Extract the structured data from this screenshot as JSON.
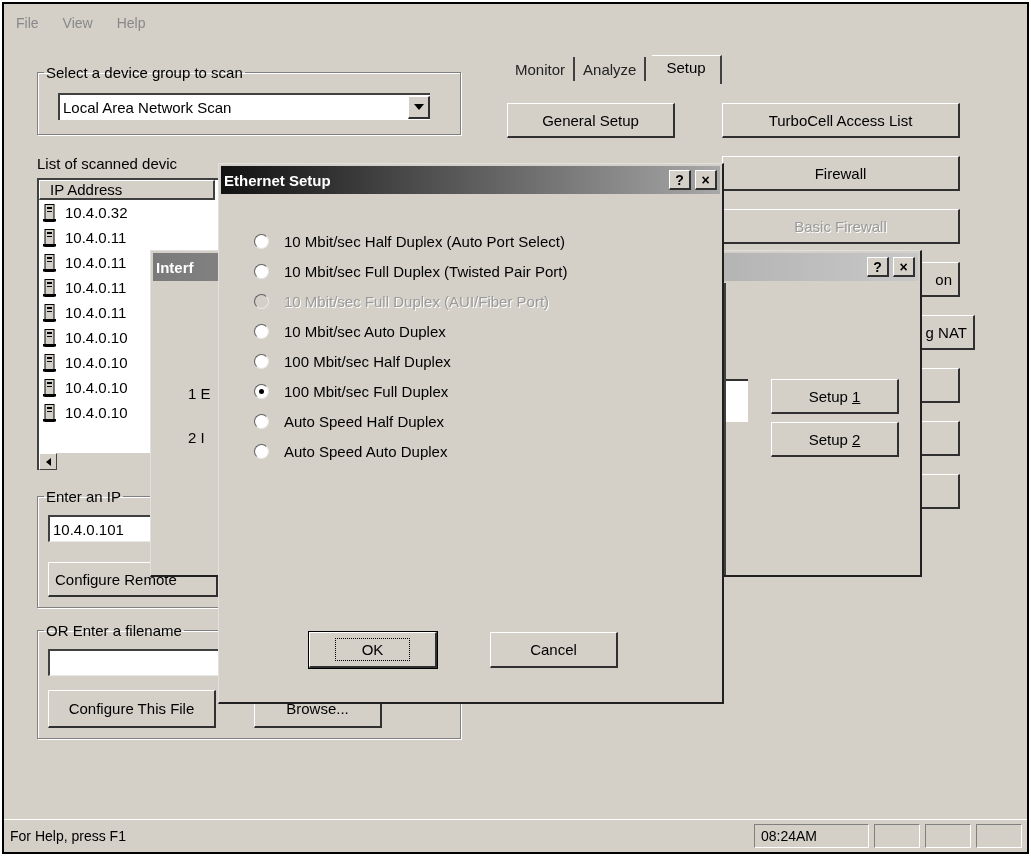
{
  "menu": [
    {
      "label": "File"
    },
    {
      "label": "View"
    },
    {
      "label": "Help"
    }
  ],
  "scan_group": {
    "legend": "Select a device group to scan",
    "combo_value": "Local Area Network Scan"
  },
  "device_list": {
    "label": "List of scanned devic",
    "column": "IP Address",
    "rows": [
      {
        "ip": "10.4.0.32"
      },
      {
        "ip": "10.4.0.11"
      },
      {
        "ip": "10.4.0.11"
      },
      {
        "ip": "10.4.0.11"
      },
      {
        "ip": "10.4.0.11"
      },
      {
        "ip": "10.4.0.10"
      },
      {
        "ip": "10.4.0.10"
      },
      {
        "ip": "10.4.0.10"
      },
      {
        "ip": "10.4.0.10"
      }
    ]
  },
  "ip_group": {
    "legend": "Enter an IP",
    "value": "10.4.0.101",
    "button": "Configure Remote"
  },
  "file_group": {
    "legend": "OR Enter a filename",
    "buttons": [
      "Configure This File",
      "Browse..."
    ]
  },
  "tabs": [
    {
      "label": "Monitor",
      "selected": false
    },
    {
      "label": "Analyze",
      "selected": false
    },
    {
      "label": "Setup",
      "selected": true
    }
  ],
  "setup_buttons": [
    {
      "label": "General Setup",
      "disabled": false
    },
    {
      "label": "TurboCell Access List",
      "disabled": false
    },
    {
      "label": "Firewall",
      "disabled": false
    },
    {
      "label": "Basic Firewall",
      "disabled": true
    }
  ],
  "covered_buttons": [
    {
      "kind": "partial",
      "label": "on"
    },
    {
      "kind": "partial",
      "label": "g NAT"
    },
    {
      "kind": "blank"
    },
    {
      "kind": "blank"
    },
    {
      "kind": "blank"
    }
  ],
  "interface_dialog": {
    "title": "Interf",
    "help_button": "?",
    "close_button": "×",
    "rows": [
      {
        "label": "1 E"
      },
      {
        "label": "2 I"
      }
    ],
    "buttons": [
      {
        "label": "Setup",
        "mnemonic": "1"
      },
      {
        "label": "Setup",
        "mnemonic": "2"
      }
    ]
  },
  "ethernet_dialog": {
    "title": "Ethernet Setup",
    "help_button": "?",
    "close_button": "×",
    "options": [
      {
        "label": "10 Mbit/sec Half Duplex (Auto Port Select)",
        "selected": false,
        "disabled": false
      },
      {
        "label": "10 Mbit/sec Full Duplex (Twisted Pair Port)",
        "selected": false,
        "disabled": false
      },
      {
        "label": "10 Mbit/sec Full Duplex (AUI/Fiber Port)",
        "selected": false,
        "disabled": true
      },
      {
        "label": "10 Mbit/sec Auto Duplex",
        "selected": false,
        "disabled": false
      },
      {
        "label": "100 Mbit/sec Half Duplex",
        "selected": false,
        "disabled": false
      },
      {
        "label": "100 Mbit/sec Full Duplex",
        "selected": true,
        "disabled": false
      },
      {
        "label": "Auto Speed Half Duplex",
        "selected": false,
        "disabled": false
      },
      {
        "label": "Auto Speed Auto Duplex",
        "selected": false,
        "disabled": false
      }
    ],
    "buttons": [
      {
        "label": "OK",
        "default": true
      },
      {
        "label": "Cancel",
        "default": false
      }
    ]
  },
  "status_bar": {
    "text": "For Help, press F1",
    "panes": [
      {
        "kind": "text",
        "text": "08:24AM"
      },
      {
        "kind": "blank"
      },
      {
        "kind": "blank"
      },
      {
        "kind": "blank"
      }
    ]
  }
}
